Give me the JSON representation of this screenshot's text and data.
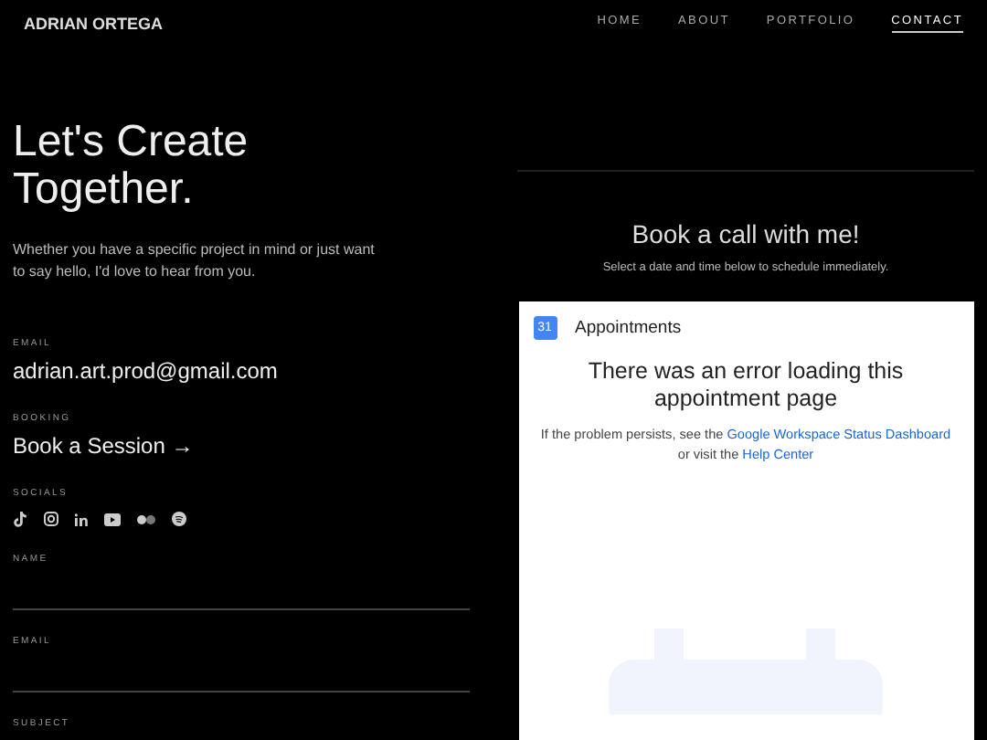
{
  "header": {
    "logo": "ADRIAN ORTEGA",
    "nav": [
      {
        "label": "HOME",
        "selected": false
      },
      {
        "label": "ABOUT",
        "selected": false
      },
      {
        "label": "PORTFOLIO",
        "selected": false
      },
      {
        "label": "CONTACT",
        "selected": true
      }
    ]
  },
  "hero": {
    "title_lines": [
      "Let's Create",
      "Together."
    ],
    "intro": "Whether you have a specific project in mind or just want to say hello, I'd love to hear from you."
  },
  "contact": [
    {
      "label": "EMAIL",
      "value": "adrian.art.prod@gmail.com"
    },
    {
      "label": "BOOKING",
      "value": "Book a Session →"
    }
  ],
  "socials": {
    "label": "SOCIALS",
    "icons": [
      {
        "kind": "tiktok"
      },
      {
        "kind": "instagram"
      },
      {
        "kind": "linkedin"
      },
      {
        "kind": "youtube"
      },
      {
        "kind": "flickr"
      },
      {
        "kind": "spotify"
      }
    ]
  },
  "form": {
    "fields": [
      {
        "label": "NAME"
      },
      {
        "label": "EMAIL"
      },
      {
        "label": "SUBJECT"
      }
    ]
  },
  "booking": {
    "title": "Book a call with me!",
    "subtitle": "Select a date and time below to schedule immediately.",
    "card": {
      "app_icon": "31",
      "app_name": "Appointments",
      "error_title": "There was an error loading this appointment page",
      "message_before": "If the problem persists, see the",
      "link_1": "Google Workspace Status Dashboard",
      "message_middle": "or visit the",
      "link_2": "Help Center"
    }
  }
}
